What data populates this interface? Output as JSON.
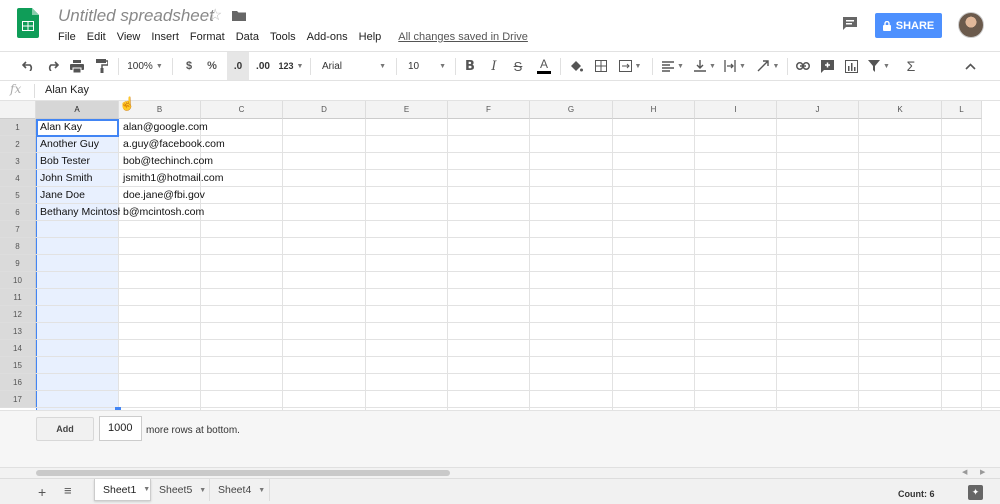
{
  "app": {
    "title": "Untitled spreadsheet",
    "save_status": "All changes saved in Drive",
    "share_label": "SHARE"
  },
  "menu": [
    "File",
    "Edit",
    "View",
    "Insert",
    "Format",
    "Data",
    "Tools",
    "Add-ons",
    "Help"
  ],
  "toolbar": {
    "zoom": "100%",
    "currency": "$",
    "percent": "%",
    "decimal_decrease": ".0",
    "decimal_increase": ".00",
    "more_formats": "123",
    "font": "Arial",
    "font_size": "10",
    "icons": [
      "undo-icon",
      "redo-icon",
      "print-icon",
      "paint-format-icon",
      "bold-icon",
      "italic-icon",
      "strikethrough-icon",
      "text-color-icon",
      "fill-color-icon",
      "borders-icon",
      "merge-cells-icon",
      "align-left-icon",
      "valign-bottom-icon",
      "text-wrap-icon",
      "text-rotate-icon",
      "link-icon",
      "comment-icon",
      "chart-icon",
      "filter-icon",
      "functions-icon",
      "collapse-icon"
    ]
  },
  "formula_bar": {
    "fx_label": "fx",
    "value": "Alan Kay"
  },
  "grid": {
    "columns": [
      "A",
      "B",
      "C",
      "D",
      "E",
      "F",
      "G",
      "H",
      "I",
      "J",
      "K",
      "L"
    ],
    "row_numbers": [
      "1",
      "2",
      "3",
      "4",
      "5",
      "6",
      "7",
      "8",
      "9",
      "10",
      "11",
      "12",
      "13",
      "14",
      "15",
      "16",
      "17"
    ],
    "rows": [
      [
        "Alan Kay",
        "alan@google.com"
      ],
      [
        "Another Guy",
        "a.guy@facebook.com"
      ],
      [
        "Bob Tester",
        "bob@techinch.com"
      ],
      [
        "John Smith",
        "jsmith1@hotmail.com"
      ],
      [
        "Jane Doe",
        "doe.jane@fbi.gov"
      ],
      [
        "Bethany Mcintosh",
        "b@mcintosh.com"
      ]
    ]
  },
  "add_rows": {
    "button_label": "Add",
    "count_value": "1000",
    "suffix": "more rows at bottom."
  },
  "sheets": {
    "tabs": [
      "Sheet1",
      "Sheet5",
      "Sheet4"
    ],
    "active": "Sheet1",
    "count_label": "Count: 6"
  },
  "colors": {
    "accent": "#4285f4",
    "share_button": "#4d90fe",
    "logo_green": "#0f9d58"
  }
}
